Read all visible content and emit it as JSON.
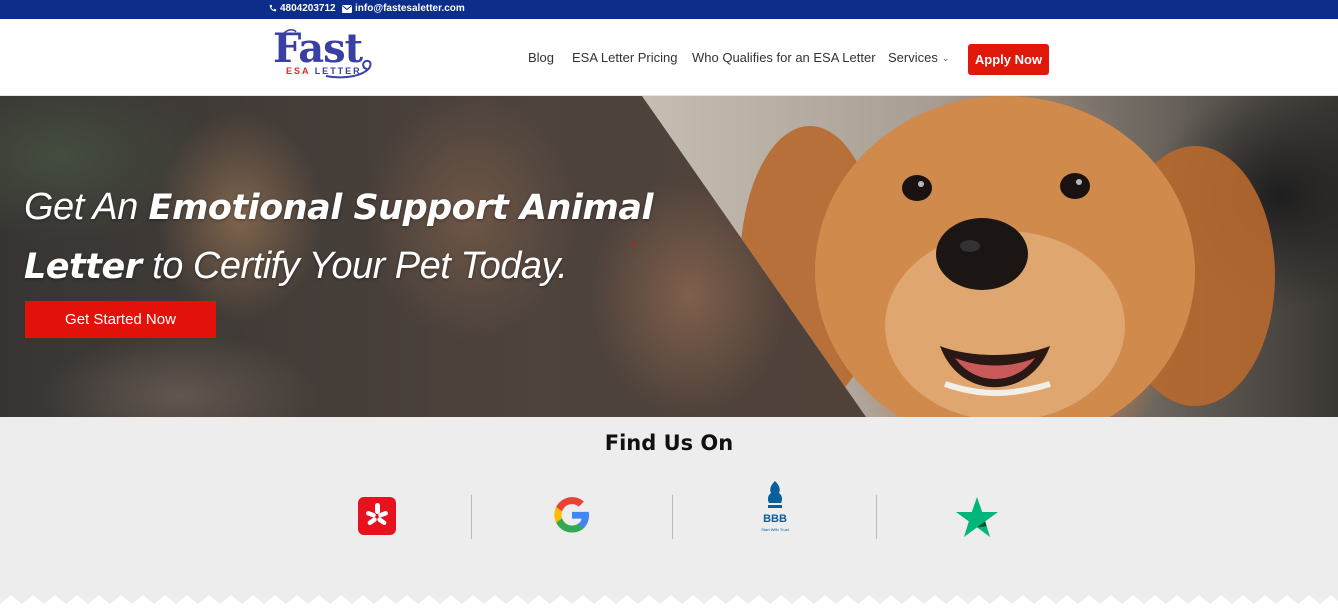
{
  "topbar": {
    "phone": "4804203712",
    "email": "info@fastesaletter.com"
  },
  "logo": {
    "word": "Fast",
    "sub_red": "ESA",
    "sub_blue": "LETTER"
  },
  "nav": {
    "items": [
      {
        "label": "Blog"
      },
      {
        "label": "ESA Letter Pricing"
      },
      {
        "label": "Who Qualifies for an ESA Letter"
      },
      {
        "label": "Services"
      }
    ],
    "cta": "Apply Now"
  },
  "hero": {
    "title_part1": "Get An",
    "title_bold1": "Emotional Support Animal",
    "title_bold2": "Letter",
    "title_part2": "to Certify Your Pet Today.",
    "button": "Get Started Now"
  },
  "find_us": {
    "heading": "Find Us On",
    "badges": [
      {
        "icon": "yelp-icon"
      },
      {
        "icon": "google-icon"
      },
      {
        "icon": "bbb-icon",
        "label": "BBB",
        "tagline": "Start With Trust"
      },
      {
        "icon": "trustpilot-star-icon"
      }
    ]
  },
  "colors": {
    "topbar": "#0c2d8a",
    "cta_red": "#e0180c",
    "logo_blue": "#3a3fa3",
    "logo_red": "#d62b2b"
  }
}
